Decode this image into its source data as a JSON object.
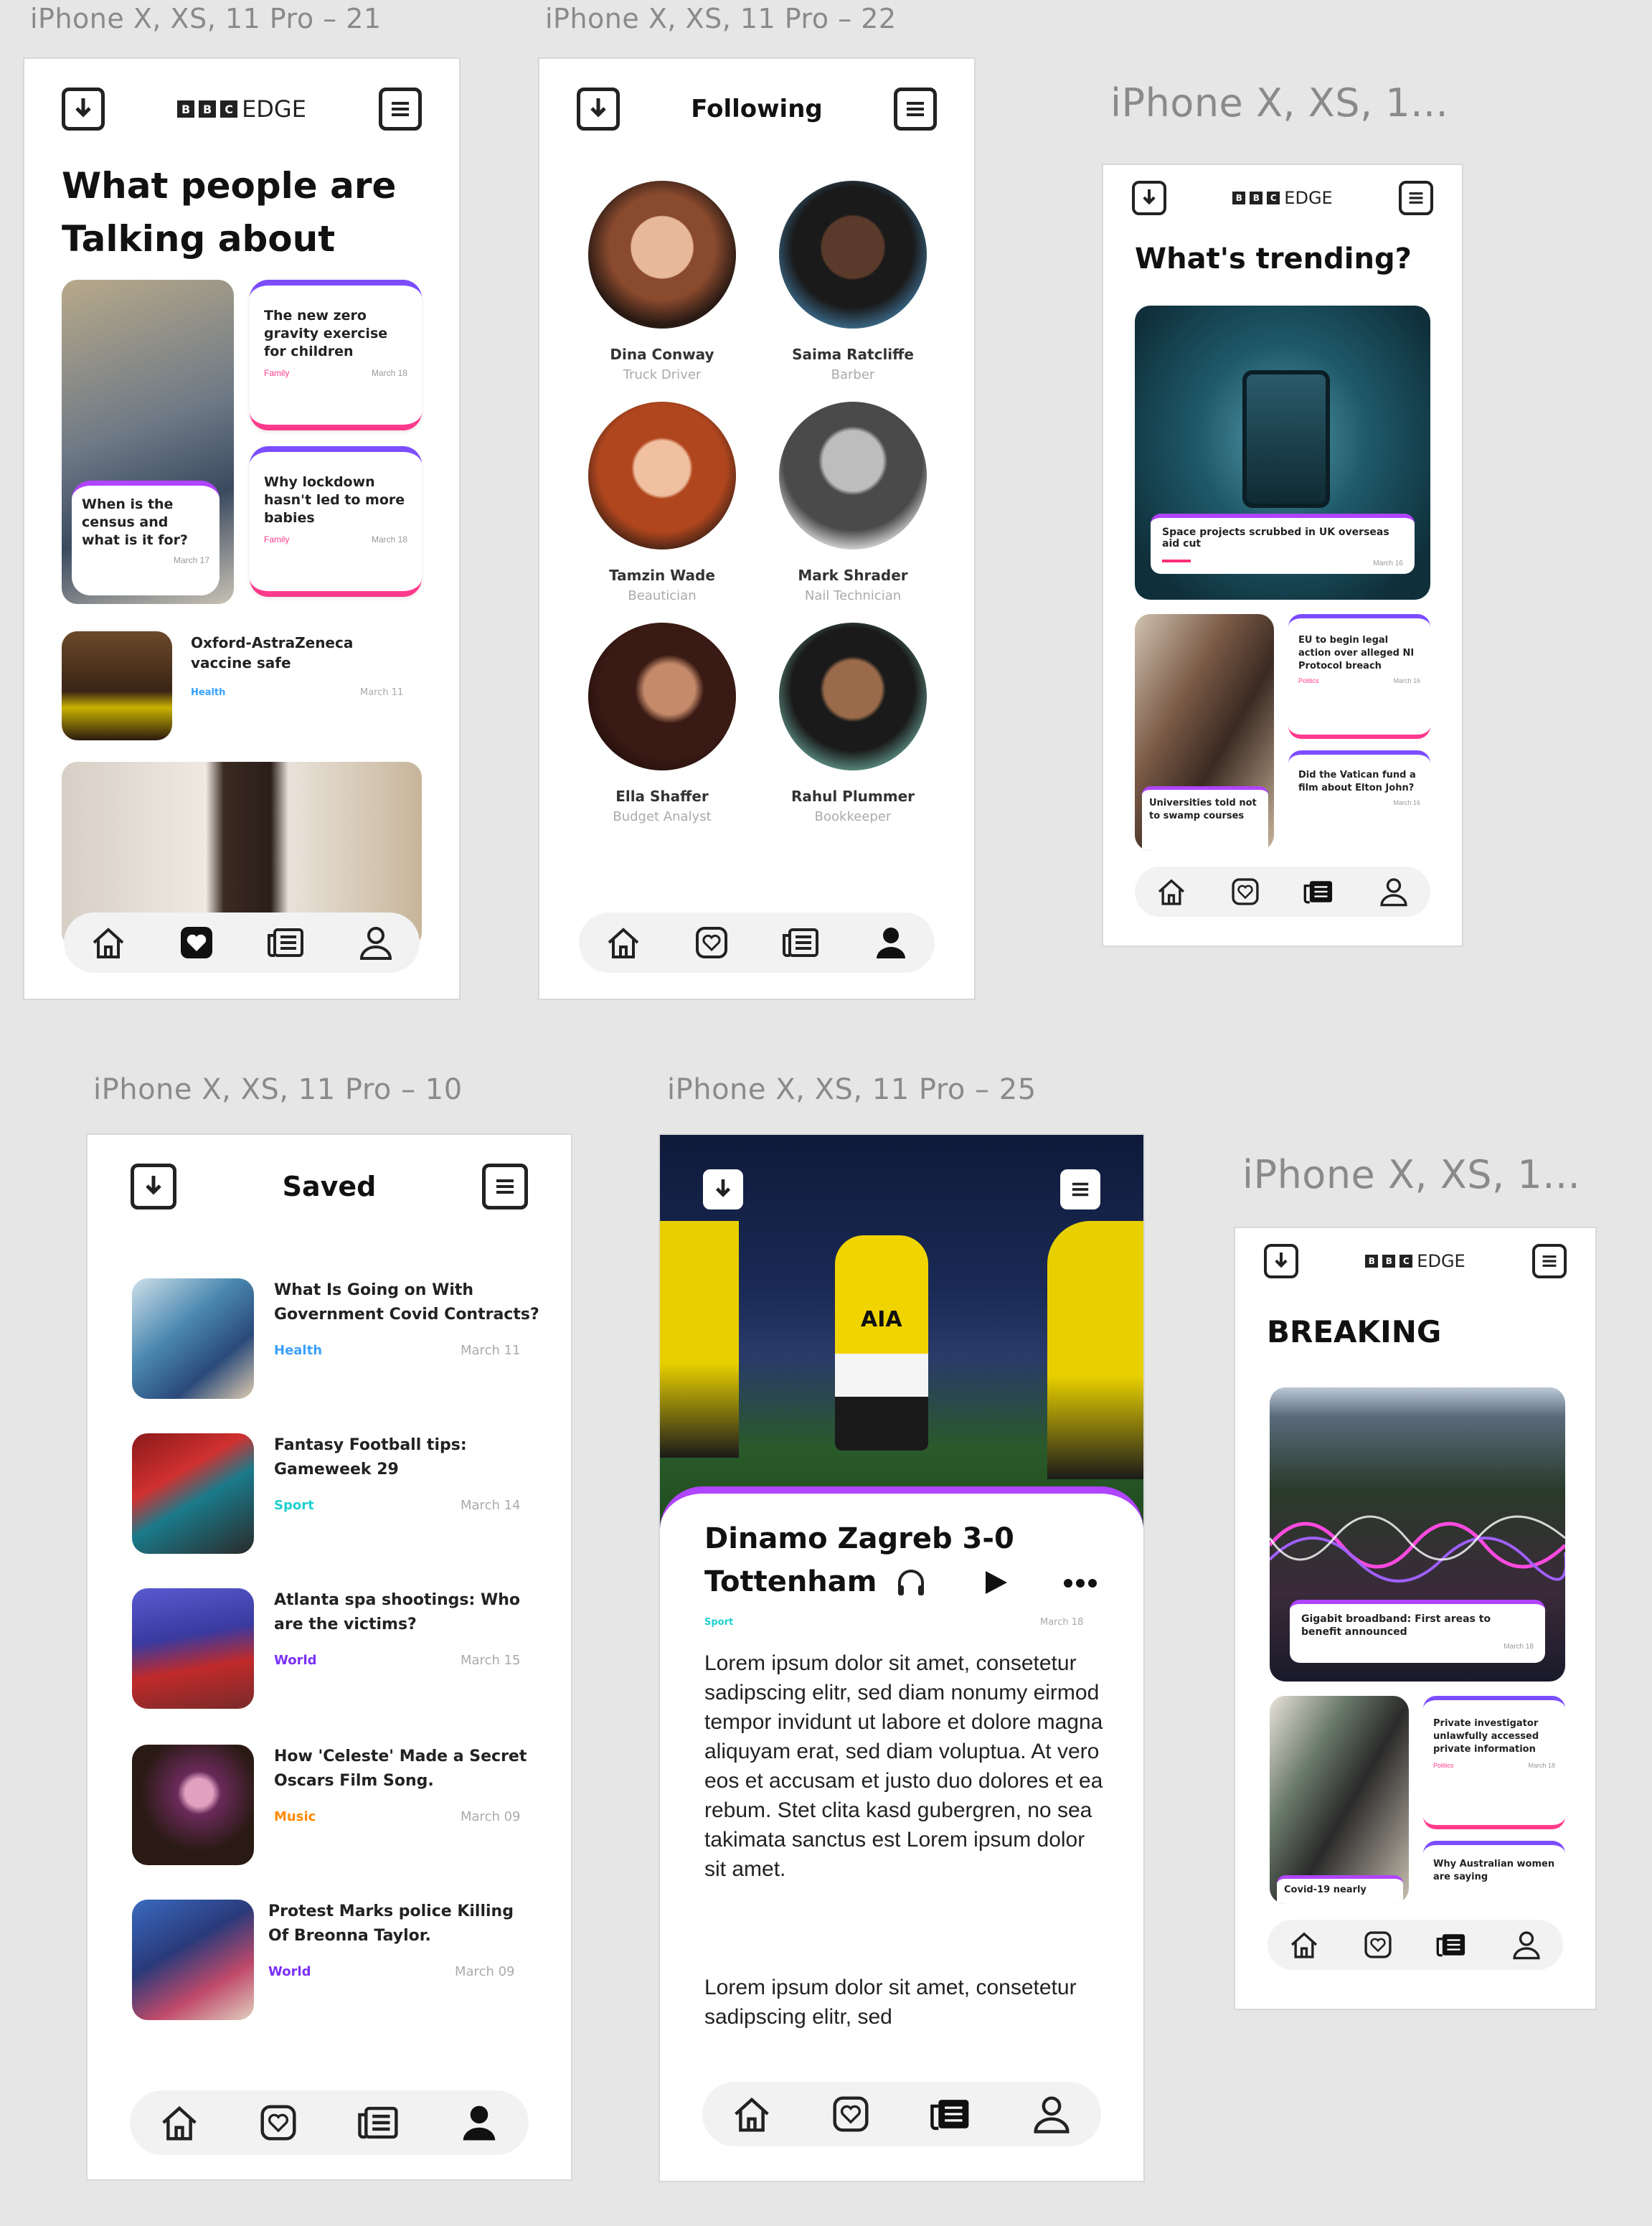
{
  "frames": {
    "f21": {
      "label": "iPhone X, XS, 11 Pro – 21",
      "logo_text": "EDGE",
      "heading": "What people are Talking about",
      "card1": {
        "title": "The new zero gravity exercise for children",
        "category": "Family",
        "date": "March 18"
      },
      "card2": {
        "title": "Why lockdown hasn't led to more babies",
        "category": "Family",
        "date": "March 18"
      },
      "card3": {
        "title": "When is the census and what is it for?",
        "category": "",
        "date": "March 17"
      },
      "row": {
        "title": "Oxford-AstraZeneca vaccine safe",
        "category": "Health",
        "date": "March 11"
      }
    },
    "f22": {
      "label": "iPhone X, XS, 11 Pro – 22",
      "heading": "Following",
      "people": [
        {
          "name": "Dina Conway",
          "role": "Truck Driver"
        },
        {
          "name": "Saima Ratcliffe",
          "role": "Barber"
        },
        {
          "name": "Tamzin Wade",
          "role": "Beautician"
        },
        {
          "name": "Mark Shrader",
          "role": "Nail Technician"
        },
        {
          "name": "Ella Shaffer",
          "role": "Budget Analyst"
        },
        {
          "name": "Rahul Plummer",
          "role": "Bookkeeper"
        }
      ]
    },
    "f_trending": {
      "label": "iPhone X, XS, 1...",
      "logo_text": "EDGE",
      "heading": "What's trending?",
      "hero_caption": "Space projects scrubbed in UK overseas aid cut",
      "hero_date": "March 16",
      "card1": {
        "title": "EU to begin legal action over alleged NI Protocol breach",
        "category": "Politics",
        "date": "March 16"
      },
      "card2": {
        "title": "Did the Vatican fund a film about Elton John?",
        "category": "",
        "date": "March 16"
      },
      "photo_caption": "Universities told not to swamp courses"
    },
    "f10": {
      "label": "iPhone X, XS, 11 Pro – 10",
      "heading": "Saved",
      "items": [
        {
          "title": "What Is Going on With Government Covid Contracts?",
          "category": "Health",
          "date": "March 11",
          "cat_color": "#3aa0ff"
        },
        {
          "title": "Fantasy Football tips: Gameweek 29",
          "category": "Sport",
          "date": "March 14",
          "cat_color": "#20d0d0"
        },
        {
          "title": "Atlanta spa shootings: Who are the victims?",
          "category": "World",
          "date": "March 15",
          "cat_color": "#7b2ff7"
        },
        {
          "title": "How 'Celeste' Made a Secret Oscars Film Song.",
          "category": "Music",
          "date": "March 09",
          "cat_color": "#ff8a00"
        },
        {
          "title": "Protest Marks police Killing Of Breonna Taylor.",
          "category": "World",
          "date": "March 09",
          "cat_color": "#7b2ff7"
        }
      ]
    },
    "f25": {
      "label": "iPhone X, XS, 11 Pro – 25",
      "title_line1": "Dinamo Zagreb 3-0",
      "title_line2": "Tottenham",
      "category": "Sport",
      "date": "March 18",
      "para1": "Lorem ipsum dolor sit amet, consetetur sadipscing elitr, sed diam nonumy eirmod tempor invidunt ut labore et dolore magna aliquyam erat, sed diam voluptua. At vero eos et accusam et justo duo dolores et ea rebum. Stet clita kasd gubergren, no sea takimata sanctus est Lorem ipsum dolor sit amet.",
      "para2": "Lorem ipsum dolor sit amet, consetetur sadipscing elitr, sed",
      "shirt_text": "AIA"
    },
    "f_breaking": {
      "label": "iPhone X, XS, 1...",
      "logo_text": "EDGE",
      "heading": "BREAKING",
      "hero_caption": "Gigabit broadband: First areas to benefit announced",
      "hero_date": "March 18",
      "card1": {
        "title": "Private investigator unlawfully accessed private information",
        "category": "Politics",
        "date": "March 18"
      },
      "card2": {
        "title": "Why Australian women are saying",
        "category": "",
        "date": ""
      },
      "photo_caption": "Covid-19 nearly"
    }
  },
  "colors": {
    "gradient_start": "#3f7bff",
    "gradient_mid": "#b044ff",
    "gradient_end": "#ff2f7a",
    "ink": "#222222"
  },
  "icons": [
    "download-icon",
    "menu-icon",
    "home-icon",
    "heart-icon",
    "news-icon",
    "user-icon",
    "headphones-icon",
    "play-icon",
    "more-icon"
  ]
}
